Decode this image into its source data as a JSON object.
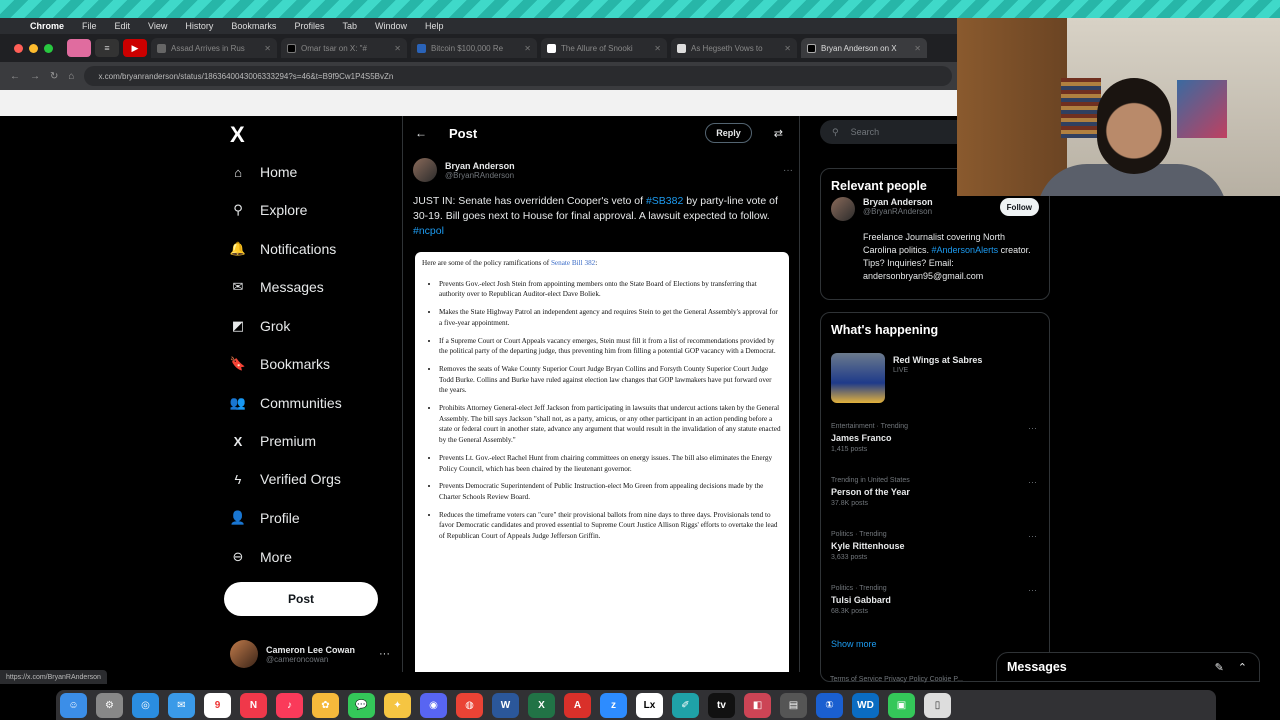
{
  "menubar": {
    "app": "Chrome",
    "items": [
      "File",
      "Edit",
      "View",
      "History",
      "Bookmarks",
      "Profiles",
      "Tab",
      "Window",
      "Help"
    ]
  },
  "browser": {
    "tabs": [
      {
        "title": "Assad Arrives in Rus"
      },
      {
        "title": "Omar tsar on X: \"#"
      },
      {
        "title": "Bitcoin $100,000 Re"
      },
      {
        "title": "The Allure of Snooki"
      },
      {
        "title": "As Hegseth Vows to"
      },
      {
        "title": "Bryan Anderson on X",
        "active": true
      }
    ],
    "url": "x.com/bryanranderson/status/1863640043006333294?s=46&t=B9f9Cw1P4S5BvZn",
    "status_url": "https://x.com/BryanRAnderson"
  },
  "nav": {
    "logo": "X",
    "items": [
      {
        "label": "Home",
        "icon": "home-icon",
        "glyph": "⌂"
      },
      {
        "label": "Explore",
        "icon": "search-icon",
        "glyph": "⚲"
      },
      {
        "label": "Notifications",
        "icon": "bell-icon",
        "glyph": "🔔"
      },
      {
        "label": "Messages",
        "icon": "envelope-icon",
        "glyph": "✉"
      },
      {
        "label": "Grok",
        "icon": "grok-icon",
        "glyph": "◩"
      },
      {
        "label": "Bookmarks",
        "icon": "bookmark-icon",
        "glyph": "🔖"
      },
      {
        "label": "Communities",
        "icon": "communities-icon",
        "glyph": "👥"
      },
      {
        "label": "Premium",
        "icon": "x-premium-icon",
        "glyph": "X"
      },
      {
        "label": "Verified Orgs",
        "icon": "lightning-icon",
        "glyph": "ϟ"
      },
      {
        "label": "Profile",
        "icon": "person-icon",
        "glyph": "👤"
      },
      {
        "label": "More",
        "icon": "more-circle-icon",
        "glyph": "⊖"
      }
    ],
    "post_button": "Post",
    "account": {
      "name": "Cameron Lee Cowan",
      "handle": "@cameroncowan"
    }
  },
  "post": {
    "header": "Post",
    "reply_label": "Reply",
    "author": {
      "name": "Bryan Anderson",
      "handle": "@BryanRAnderson"
    },
    "text_1": "JUST IN: Senate has overridden Cooper's veto of ",
    "tag_1": "#SB382",
    "text_2": " by party-line vote of 30-19. Bill goes next to House for final approval. A lawsuit expected to follow. ",
    "tag_2": "#ncpol",
    "doc_intro": "Here are some of the policy ramifications of ",
    "doc_intro_link": "Senate Bill 382",
    "doc_bullets": [
      "Prevents Gov.-elect Josh Stein from appointing members onto the State Board of Elections by transferring that authority over to Republican Auditor-elect Dave Boliek.",
      "Makes the State Highway Patrol an independent agency and requires Stein to get the General Assembly's approval for a five-year appointment.",
      "If a Supreme Court or Court Appeals vacancy emerges, Stein must fill it from a list of recommendations provided by the political party of the departing judge, thus preventing him from filling a potential GOP vacancy with a Democrat.",
      "Removes the seats of Wake County Superior Court Judge Bryan Collins and Forsyth County Superior Court Judge Todd Burke. Collins and Burke have ruled against election law changes that GOP lawmakers have put forward over the years.",
      "Prohibits Attorney General-elect Jeff Jackson from participating in lawsuits that undercut actions taken by the General Assembly. The bill says Jackson \"shall not, as a party, amicus, or any other participant in an action pending before a state or federal court in another state, advance any argument that would result in the invalidation of any statute enacted by the General Assembly.\"",
      "Prevents Lt. Gov.-elect Rachel Hunt from chairing committees on energy issues. The bill also eliminates the Energy Policy Council, which has been chaired by the lieutenant governor.",
      "Prevents Democratic Superintendent of Public Instruction-elect Mo Green from appealing decisions made by the Charter Schools Review Board.",
      "Reduces the timeframe voters can \"cure\" their provisional ballots from nine days to three days. Provisionals tend to favor Democratic candidates and proved essential to Supreme Court Justice Allison Riggs' efforts to overtake the lead of Republican Court of Appeals Judge Jefferson Griffin."
    ]
  },
  "sidebar": {
    "search_placeholder": "Search",
    "relevant_title": "Relevant people",
    "relevant": {
      "name": "Bryan Anderson",
      "handle": "@BryanRAnderson",
      "follow": "Follow",
      "bio_1": "Freelance Journalist covering North Carolina politics. ",
      "bio_link": "#AndersonAlerts",
      "bio_2": " creator. Tips? Inquiries? Email: andersonbryan95@gmail.com"
    },
    "happening_title": "What's happening",
    "spotlight": {
      "title": "Red Wings at Sabres",
      "sub": "LIVE"
    },
    "trends": [
      {
        "category": "Entertainment · Trending",
        "name": "James Franco",
        "count": "1,415 posts"
      },
      {
        "category": "Trending in United States",
        "name": "Person of the Year",
        "count": "37.8K posts"
      },
      {
        "category": "Politics · Trending",
        "name": "Kyle Rittenhouse",
        "count": "3,633 posts"
      },
      {
        "category": "Politics · Trending",
        "name": "Tulsi Gabbard",
        "count": "68.3K posts"
      }
    ],
    "show_more": "Show more",
    "footer": "Terms of Service  Privacy Policy  Cookie P..."
  },
  "messages_dock": {
    "label": "Messages"
  },
  "dock_apps": [
    "Finder",
    "Settings",
    "Safari",
    "Mail",
    "Calendar",
    "News",
    "Music",
    "Photos",
    "Messages",
    "Freeform",
    "Discord",
    "Chrome",
    "Word",
    "Excel",
    "Acrobat",
    "Zoom",
    "Lex",
    "Notes",
    "TV",
    "Preview",
    "Pages",
    "1Password",
    "WD",
    "FaceTime",
    "Files"
  ]
}
